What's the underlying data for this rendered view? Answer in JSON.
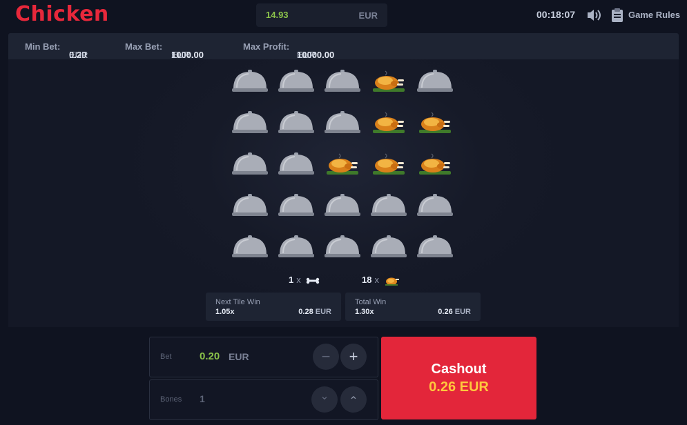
{
  "header": {
    "logo": "Chicken",
    "balance_amount": "14.93",
    "balance_currency": "EUR",
    "timer": "00:18:07",
    "rules_label": "Game Rules"
  },
  "limits": {
    "min_bet_label": "Min Bet:",
    "min_bet_value": "0.20",
    "max_bet_label": "Max Bet:",
    "max_bet_value": "1000.00",
    "max_profit_label": "Max Profit:",
    "max_profit_value": "10000.00",
    "currency": "EUR"
  },
  "board": {
    "rows": [
      [
        "dome",
        "dome",
        "dome",
        "chicken",
        "dome"
      ],
      [
        "dome",
        "dome",
        "dome",
        "chicken",
        "chicken"
      ],
      [
        "dome",
        "dome",
        "chicken",
        "chicken",
        "chicken"
      ],
      [
        "dome",
        "dome",
        "dome",
        "dome",
        "dome"
      ],
      [
        "dome",
        "dome",
        "dome",
        "dome",
        "dome"
      ]
    ]
  },
  "counts": {
    "bones": "1",
    "chickens": "18",
    "times": "x"
  },
  "stats": {
    "next_title": "Next Tile Win",
    "next_mult": "1.05x",
    "next_amount": "0.28",
    "total_title": "Total Win",
    "total_mult": "1.30x",
    "total_amount": "0.26",
    "currency": "EUR"
  },
  "controls": {
    "bet_label": "Bet",
    "bet_value": "0.20",
    "bet_currency": "EUR",
    "minus": "−",
    "plus": "+",
    "bones_label": "Bones",
    "bones_value": "1",
    "down": "⌄",
    "up": "⌃"
  },
  "cashout": {
    "label": "Cashout",
    "amount": "0.26 EUR"
  },
  "colors": {
    "brand_red": "#e3263a",
    "balance_green": "#8bc34a",
    "cashout_amount": "#ffc83d"
  }
}
